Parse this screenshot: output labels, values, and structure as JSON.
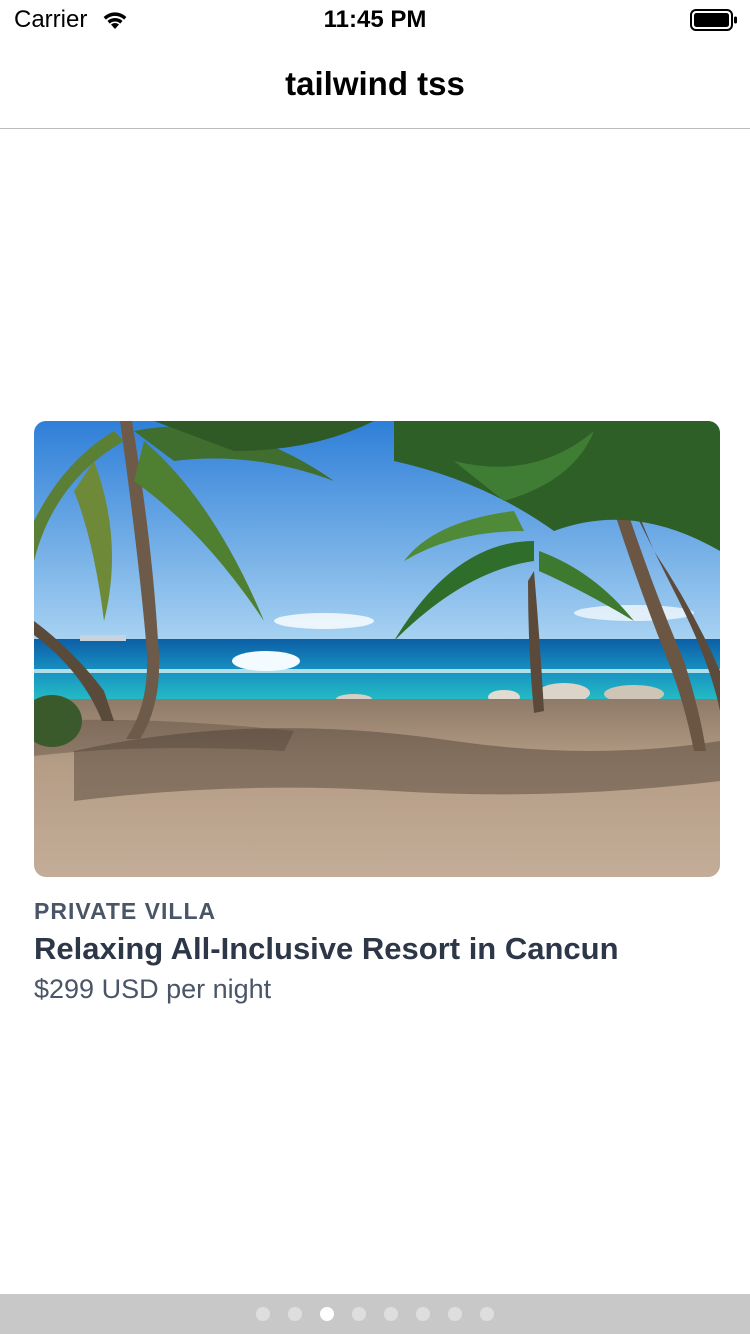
{
  "status_bar": {
    "carrier": "Carrier",
    "time": "11:45 PM",
    "icons": [
      "wifi-icon",
      "battery-icon"
    ]
  },
  "nav": {
    "title": "tailwind tss"
  },
  "card": {
    "image": "beach-palm-trees-photo",
    "eyebrow": "PRIVATE VILLA",
    "title": "Relaxing All-Inclusive Resort in Cancun",
    "price": "$299 USD per night"
  },
  "pager": {
    "page_count": 8,
    "current_page": 3
  },
  "colors": {
    "eyebrow": "#4a5568",
    "title": "#2d3748",
    "price": "#4a5568",
    "pager_bg": "#c8c8c8",
    "dot_active": "#ffffff",
    "dot_inactive": "#dedede"
  }
}
